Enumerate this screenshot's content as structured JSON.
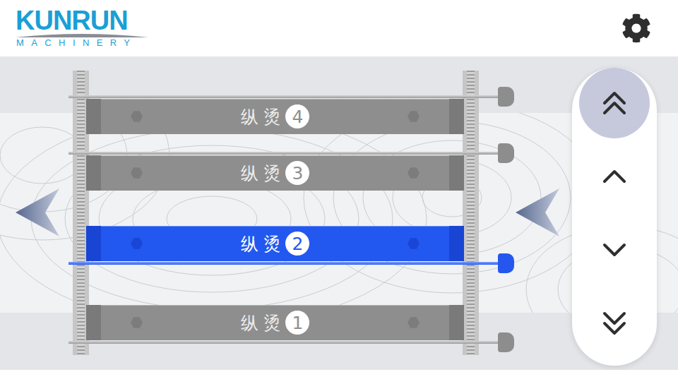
{
  "header": {
    "logo": {
      "name": "KUNRUN",
      "tagline": "MACHINERY"
    }
  },
  "bars": [
    {
      "label": "纵 烫",
      "number": "4",
      "selected": false
    },
    {
      "label": "纵 烫",
      "number": "3",
      "selected": false
    },
    {
      "label": "纵 烫",
      "number": "2",
      "selected": true
    },
    {
      "label": "纵 烫",
      "number": "1",
      "selected": false
    }
  ],
  "controls": [
    {
      "kind": "fast-up",
      "selected": true
    },
    {
      "kind": "up",
      "selected": false
    },
    {
      "kind": "down",
      "selected": false
    },
    {
      "kind": "fast-down",
      "selected": false
    }
  ]
}
